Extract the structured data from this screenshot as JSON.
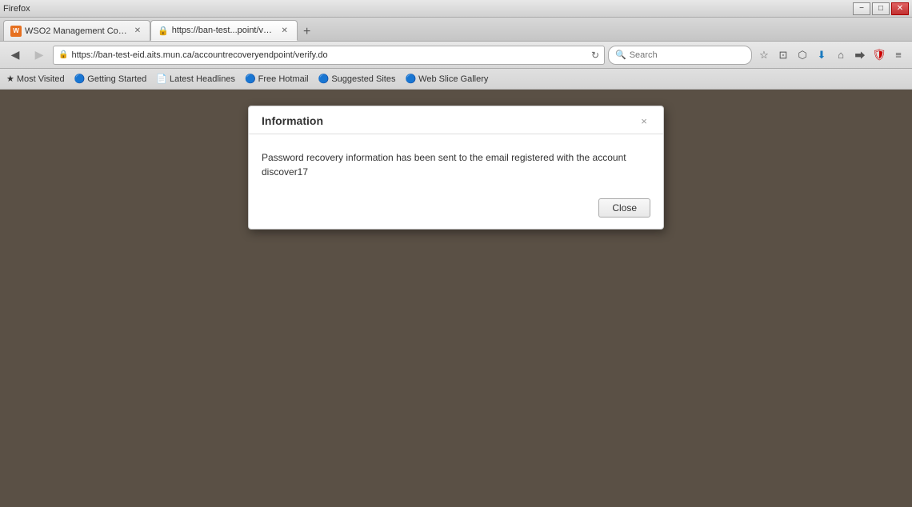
{
  "titlebar": {
    "title": "Firefox",
    "minimize_label": "−",
    "maximize_label": "□",
    "close_label": "✕"
  },
  "tabs": [
    {
      "id": "tab1",
      "label": "WSO2 Management Console",
      "favicon": "W",
      "active": false
    },
    {
      "id": "tab2",
      "label": "https://ban-test...point/verify.do",
      "favicon": "🔒",
      "active": true
    }
  ],
  "tab_new_label": "+",
  "navbar": {
    "back_label": "◀",
    "forward_label": "▶",
    "refresh_label": "↻",
    "home_label": "⌂",
    "address": "https://ban-test-eid.aits.mun.ca/accountrecoveryendpoint/verify.do",
    "search_placeholder": "Search",
    "search_value": ""
  },
  "bookmarks": [
    {
      "label": "Most Visited",
      "icon": "★"
    },
    {
      "label": "Getting Started",
      "icon": "🔵"
    },
    {
      "label": "Latest Headlines",
      "icon": "📄"
    },
    {
      "label": "Free Hotmail",
      "icon": "🔵"
    },
    {
      "label": "Suggested Sites",
      "icon": "🔵"
    },
    {
      "label": "Web Slice Gallery",
      "icon": "🔵"
    }
  ],
  "modal": {
    "title": "Information",
    "close_x_label": "×",
    "body_text": "Password recovery information has been sent to the email registered with the account discover17",
    "close_button_label": "Close"
  }
}
